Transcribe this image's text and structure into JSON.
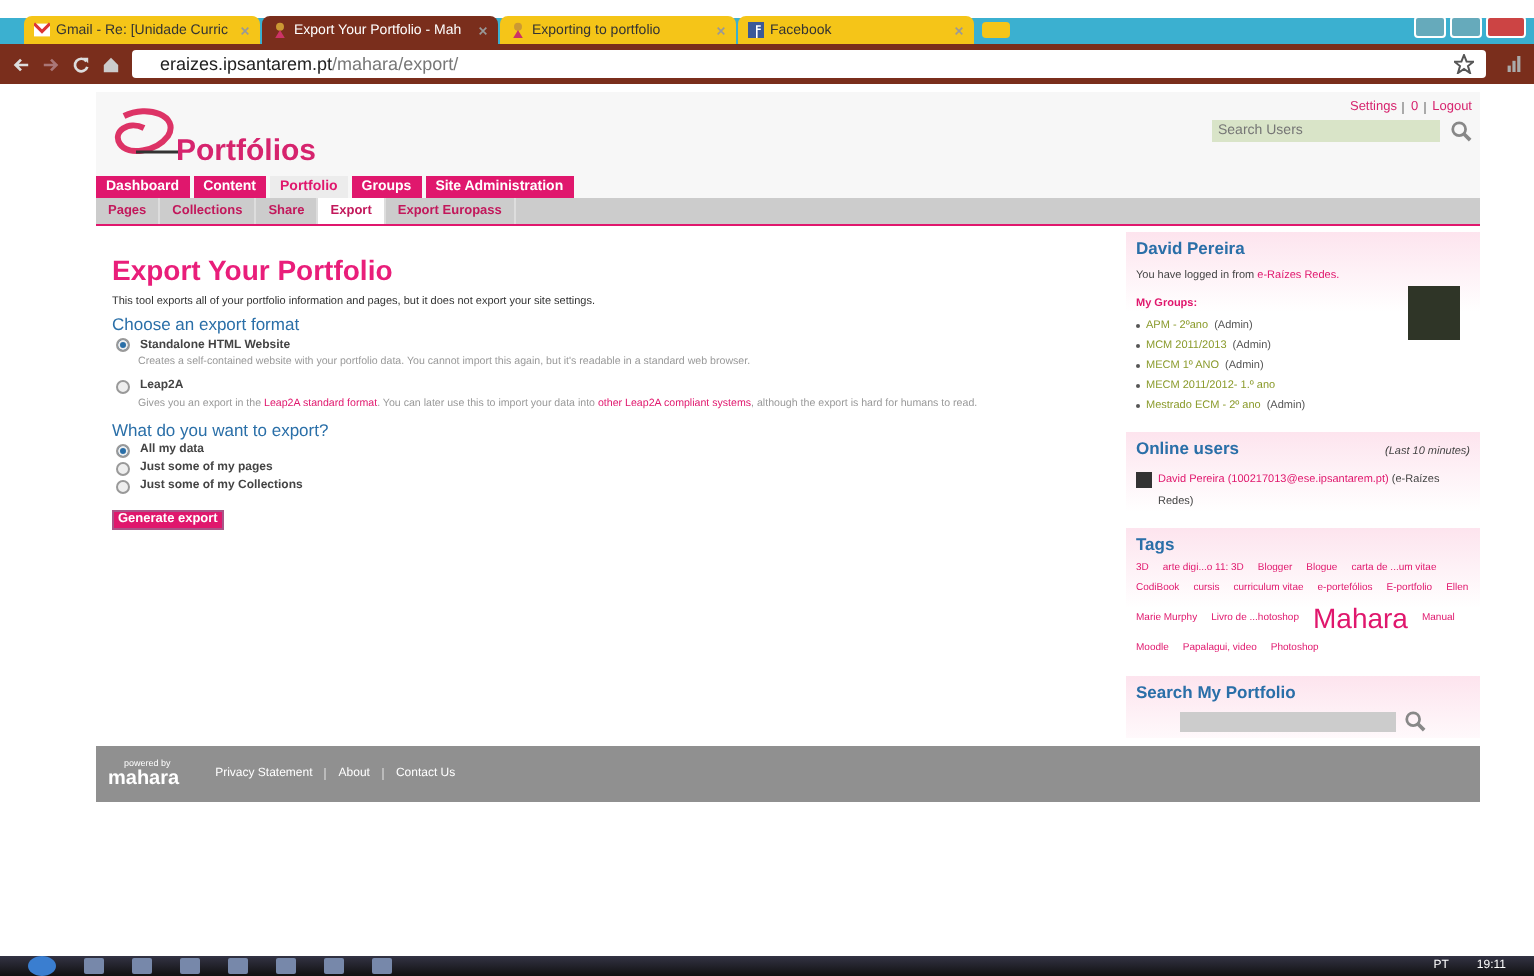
{
  "browser": {
    "tabs": [
      {
        "title": "Gmail - Re: [Unidade Curric",
        "selected": false
      },
      {
        "title": "Export Your Portfolio - Mah",
        "selected": true
      },
      {
        "title": "Exporting to portfolio",
        "selected": false
      },
      {
        "title": "Facebook",
        "selected": false
      }
    ],
    "address": {
      "host": "eraizes.ipsantarem.pt",
      "path": "/mahara/export/"
    }
  },
  "header": {
    "logo": "Portfólios",
    "links": [
      "Settings",
      "0",
      "Logout"
    ],
    "search_placeholder": "Search Users"
  },
  "nav": [
    {
      "label": "Dashboard",
      "selected": false
    },
    {
      "label": "Content",
      "selected": false
    },
    {
      "label": "Portfolio",
      "selected": true
    },
    {
      "label": "Groups",
      "selected": false
    },
    {
      "label": "Site Administration",
      "selected": false
    }
  ],
  "subnav": [
    {
      "label": "Pages",
      "selected": false
    },
    {
      "label": "Collections",
      "selected": false
    },
    {
      "label": "Share",
      "selected": false
    },
    {
      "label": "Export",
      "selected": true
    },
    {
      "label": "Export Europass",
      "selected": false
    }
  ],
  "main": {
    "title": "Export Your Portfolio",
    "intro": "This tool exports all of your portfolio information and pages, but it does not export your site settings.",
    "sections": [
      {
        "heading": "Choose an export format",
        "options": [
          {
            "label": "Standalone HTML Website",
            "selected": true,
            "desc": [
              {
                "kind": "text",
                "text": "Creates a self-contained website with your portfolio data. You cannot import this again, but it's readable in a standard web browser."
              }
            ]
          },
          {
            "label": "Leap2A",
            "selected": false,
            "desc": [
              {
                "kind": "text",
                "text": "Gives you an export in the "
              },
              {
                "kind": "link",
                "text": "Leap2A standard format"
              },
              {
                "kind": "text",
                "text": ". You can later use this to import your data into "
              },
              {
                "kind": "link",
                "text": "other Leap2A compliant systems"
              },
              {
                "kind": "text",
                "text": ", although the export is hard for humans to read."
              }
            ]
          }
        ]
      },
      {
        "heading": "What do you want to export?",
        "options": [
          {
            "label": "All my data",
            "selected": true
          },
          {
            "label": "Just some of my pages",
            "selected": false
          },
          {
            "label": "Just some of my Collections",
            "selected": false
          }
        ]
      }
    ],
    "button": "Generate export"
  },
  "sidebar": {
    "profile": {
      "name": "David Pereira",
      "login_text": "You have logged in from",
      "login_link": "e-Raízes Redes.",
      "groups_heading": "My Groups:",
      "groups": [
        {
          "name": "APM - 2ºano",
          "role": "(Admin)"
        },
        {
          "name": "MCM 2011/2013",
          "role": "(Admin)"
        },
        {
          "name": "MECM 1º ANO",
          "role": "(Admin)"
        },
        {
          "name": "MECM 2011/2012- 1.º ano"
        },
        {
          "name": "Mestrado ECM - 2º ano",
          "role": "(Admin)"
        }
      ]
    },
    "online": {
      "title": "Online users",
      "note": "(Last 10 minutes)",
      "users": [
        {
          "name": "David Pereira (100217013@ese.ipsantarem.pt)",
          "suffix": "(e-Raízes Redes)"
        }
      ]
    },
    "tags": {
      "title": "Tags",
      "items": [
        {
          "label": "3D",
          "kind": "small"
        },
        {
          "label": "arte digi...o 11: 3D",
          "kind": "small"
        },
        {
          "label": "Blogger",
          "kind": "small"
        },
        {
          "label": "Blogue",
          "kind": "small"
        },
        {
          "label": "carta de ...um vitae",
          "kind": "small"
        },
        {
          "label": "CodiBook",
          "kind": "small"
        },
        {
          "label": "cursis",
          "kind": "small"
        },
        {
          "label": "curriculum vitae",
          "kind": "small"
        },
        {
          "label": "e-portefólios",
          "kind": "small"
        },
        {
          "label": "E-portfolio",
          "kind": "small"
        },
        {
          "label": "Ellen",
          "kind": "small"
        },
        {
          "label": "Marie Murphy",
          "kind": "small"
        },
        {
          "label": "Livro de ...hotoshop",
          "kind": "small"
        },
        {
          "label": "Mahara",
          "kind": "large"
        },
        {
          "label": "Manual",
          "kind": "small"
        },
        {
          "label": "Moodle",
          "kind": "small"
        },
        {
          "label": "Papalagui, video",
          "kind": "small"
        },
        {
          "label": "Photoshop",
          "kind": "small"
        }
      ]
    },
    "search": {
      "title": "Search My Portfolio"
    }
  },
  "footer": {
    "powered_by": "powered by",
    "brand": "mahara",
    "links": [
      "Privacy Statement",
      "About",
      "Contact Us"
    ]
  },
  "taskbar": {
    "language": "PT",
    "time": "19:11"
  }
}
